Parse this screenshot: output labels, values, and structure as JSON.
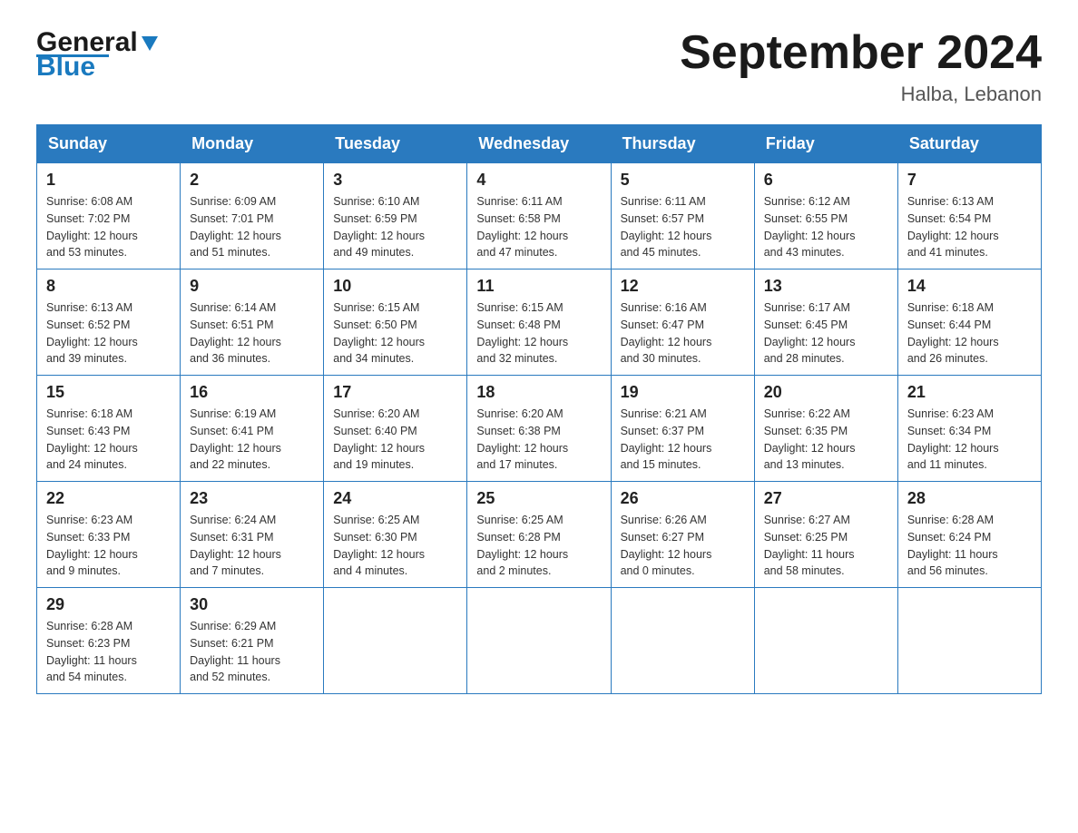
{
  "logo": {
    "text1": "General",
    "text2": "Blue"
  },
  "title": "September 2024",
  "subtitle": "Halba, Lebanon",
  "weekdays": [
    "Sunday",
    "Monday",
    "Tuesday",
    "Wednesday",
    "Thursday",
    "Friday",
    "Saturday"
  ],
  "weeks": [
    [
      {
        "day": "1",
        "info": "Sunrise: 6:08 AM\nSunset: 7:02 PM\nDaylight: 12 hours\nand 53 minutes."
      },
      {
        "day": "2",
        "info": "Sunrise: 6:09 AM\nSunset: 7:01 PM\nDaylight: 12 hours\nand 51 minutes."
      },
      {
        "day": "3",
        "info": "Sunrise: 6:10 AM\nSunset: 6:59 PM\nDaylight: 12 hours\nand 49 minutes."
      },
      {
        "day": "4",
        "info": "Sunrise: 6:11 AM\nSunset: 6:58 PM\nDaylight: 12 hours\nand 47 minutes."
      },
      {
        "day": "5",
        "info": "Sunrise: 6:11 AM\nSunset: 6:57 PM\nDaylight: 12 hours\nand 45 minutes."
      },
      {
        "day": "6",
        "info": "Sunrise: 6:12 AM\nSunset: 6:55 PM\nDaylight: 12 hours\nand 43 minutes."
      },
      {
        "day": "7",
        "info": "Sunrise: 6:13 AM\nSunset: 6:54 PM\nDaylight: 12 hours\nand 41 minutes."
      }
    ],
    [
      {
        "day": "8",
        "info": "Sunrise: 6:13 AM\nSunset: 6:52 PM\nDaylight: 12 hours\nand 39 minutes."
      },
      {
        "day": "9",
        "info": "Sunrise: 6:14 AM\nSunset: 6:51 PM\nDaylight: 12 hours\nand 36 minutes."
      },
      {
        "day": "10",
        "info": "Sunrise: 6:15 AM\nSunset: 6:50 PM\nDaylight: 12 hours\nand 34 minutes."
      },
      {
        "day": "11",
        "info": "Sunrise: 6:15 AM\nSunset: 6:48 PM\nDaylight: 12 hours\nand 32 minutes."
      },
      {
        "day": "12",
        "info": "Sunrise: 6:16 AM\nSunset: 6:47 PM\nDaylight: 12 hours\nand 30 minutes."
      },
      {
        "day": "13",
        "info": "Sunrise: 6:17 AM\nSunset: 6:45 PM\nDaylight: 12 hours\nand 28 minutes."
      },
      {
        "day": "14",
        "info": "Sunrise: 6:18 AM\nSunset: 6:44 PM\nDaylight: 12 hours\nand 26 minutes."
      }
    ],
    [
      {
        "day": "15",
        "info": "Sunrise: 6:18 AM\nSunset: 6:43 PM\nDaylight: 12 hours\nand 24 minutes."
      },
      {
        "day": "16",
        "info": "Sunrise: 6:19 AM\nSunset: 6:41 PM\nDaylight: 12 hours\nand 22 minutes."
      },
      {
        "day": "17",
        "info": "Sunrise: 6:20 AM\nSunset: 6:40 PM\nDaylight: 12 hours\nand 19 minutes."
      },
      {
        "day": "18",
        "info": "Sunrise: 6:20 AM\nSunset: 6:38 PM\nDaylight: 12 hours\nand 17 minutes."
      },
      {
        "day": "19",
        "info": "Sunrise: 6:21 AM\nSunset: 6:37 PM\nDaylight: 12 hours\nand 15 minutes."
      },
      {
        "day": "20",
        "info": "Sunrise: 6:22 AM\nSunset: 6:35 PM\nDaylight: 12 hours\nand 13 minutes."
      },
      {
        "day": "21",
        "info": "Sunrise: 6:23 AM\nSunset: 6:34 PM\nDaylight: 12 hours\nand 11 minutes."
      }
    ],
    [
      {
        "day": "22",
        "info": "Sunrise: 6:23 AM\nSunset: 6:33 PM\nDaylight: 12 hours\nand 9 minutes."
      },
      {
        "day": "23",
        "info": "Sunrise: 6:24 AM\nSunset: 6:31 PM\nDaylight: 12 hours\nand 7 minutes."
      },
      {
        "day": "24",
        "info": "Sunrise: 6:25 AM\nSunset: 6:30 PM\nDaylight: 12 hours\nand 4 minutes."
      },
      {
        "day": "25",
        "info": "Sunrise: 6:25 AM\nSunset: 6:28 PM\nDaylight: 12 hours\nand 2 minutes."
      },
      {
        "day": "26",
        "info": "Sunrise: 6:26 AM\nSunset: 6:27 PM\nDaylight: 12 hours\nand 0 minutes."
      },
      {
        "day": "27",
        "info": "Sunrise: 6:27 AM\nSunset: 6:25 PM\nDaylight: 11 hours\nand 58 minutes."
      },
      {
        "day": "28",
        "info": "Sunrise: 6:28 AM\nSunset: 6:24 PM\nDaylight: 11 hours\nand 56 minutes."
      }
    ],
    [
      {
        "day": "29",
        "info": "Sunrise: 6:28 AM\nSunset: 6:23 PM\nDaylight: 11 hours\nand 54 minutes."
      },
      {
        "day": "30",
        "info": "Sunrise: 6:29 AM\nSunset: 6:21 PM\nDaylight: 11 hours\nand 52 minutes."
      },
      {
        "day": "",
        "info": ""
      },
      {
        "day": "",
        "info": ""
      },
      {
        "day": "",
        "info": ""
      },
      {
        "day": "",
        "info": ""
      },
      {
        "day": "",
        "info": ""
      }
    ]
  ]
}
